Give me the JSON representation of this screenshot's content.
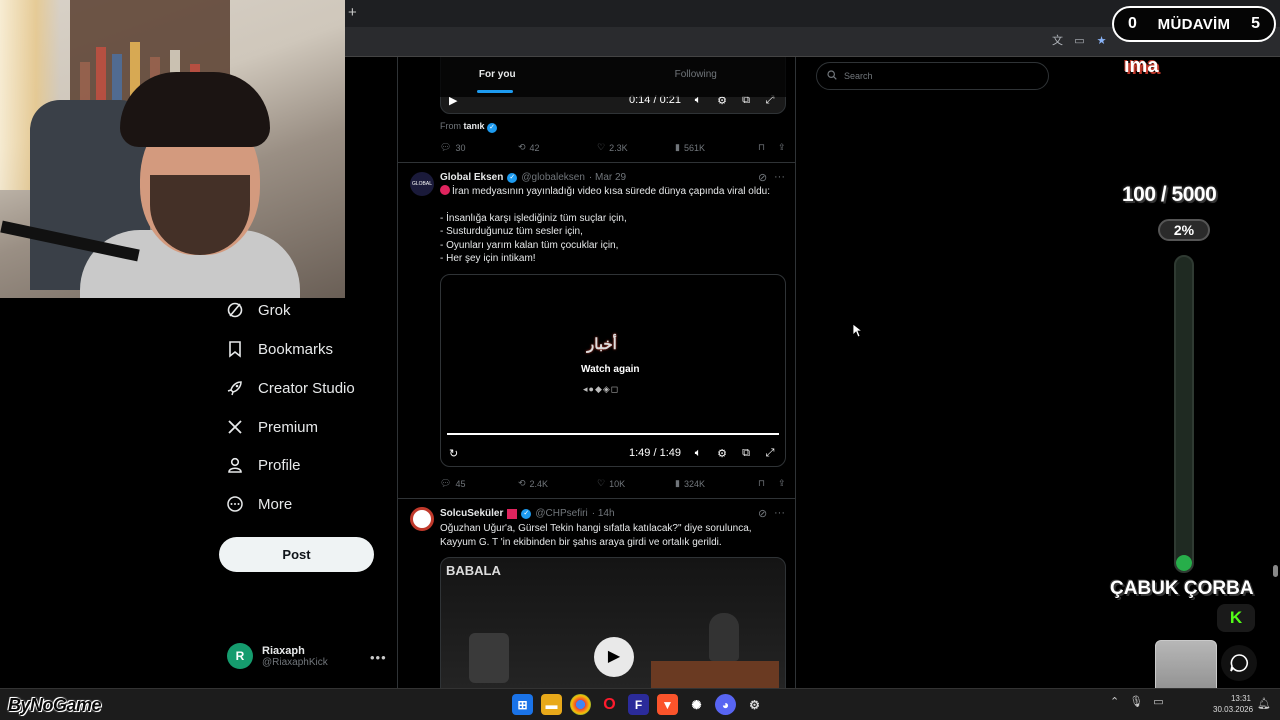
{
  "stream_counter": {
    "left": "0",
    "label": "MÜDAVİM",
    "right": "5"
  },
  "browser": {
    "new_tab": "+"
  },
  "nav": {
    "items": [
      {
        "label": "Grok",
        "icon": "grok-icon"
      },
      {
        "label": "Bookmarks",
        "icon": "bookmark-icon"
      },
      {
        "label": "Creator Studio",
        "icon": "rocket-icon"
      },
      {
        "label": "Premium",
        "icon": "x-logo-icon"
      },
      {
        "label": "Profile",
        "icon": "person-icon"
      },
      {
        "label": "More",
        "icon": "more-circle-icon"
      }
    ],
    "post_label": "Post",
    "account": {
      "avatar_letter": "R",
      "name": "Riaxaph",
      "handle": "@RiaxaphKick"
    }
  },
  "timeline": {
    "tabs": [
      {
        "label": "For you",
        "active": true
      },
      {
        "label": "Following",
        "active": false
      }
    ],
    "tweet0": {
      "video_time": "0:14 / 0:21",
      "from_label": "From",
      "from_user": "tanık",
      "stats": {
        "replies": "30",
        "reposts": "42",
        "likes": "2.3K",
        "views": "561K"
      }
    },
    "tweet1": {
      "avatar_text": "GLOBAL EKSEN",
      "name": "Global Eksen",
      "handle": "@globaleksen",
      "date": "· Mar 29",
      "text_line1": "İran medyasının yayınladığı video kısa sürede dünya çapında viral oldu:",
      "lines": [
        "- İnsanlığa karşı işlediğiniz tüm suçlar için,",
        "- Susturduğunuz tüm sesler için,",
        "- Oyunları yarım kalan tüm çocuklar için,",
        "- Her şey için intikam!"
      ],
      "video_logo": "أخبار",
      "watch_again": "Watch again",
      "video_time": "1:49 / 1:49",
      "stats": {
        "replies": "45",
        "reposts": "2.4K",
        "likes": "10K",
        "views": "324K"
      }
    },
    "tweet2": {
      "name": "SolcuSeküler",
      "handle": "@CHPsefiri",
      "date": "· 14h",
      "text": "Oğuzhan Uğur'a, Gürsel Tekin hangi sıfatla katılacak?\" diye sorulunca, Kayyum G. T 'in ekibinden bir şahıs araya girdi ve ortalık gerildi.",
      "video_logo": "BABALA"
    }
  },
  "search": {
    "placeholder": "Search"
  },
  "overlay": {
    "top_text": "ıma",
    "goal_text": "100 / 5000",
    "percent_text": "2%",
    "progress": 0.02,
    "sponsor_text": "ÇABUK ÇORBA",
    "kick_text": "K"
  },
  "taskbar": {
    "brand": "ByNoGame",
    "apps": [
      "windows-start-icon",
      "file-explorer-icon",
      "chrome-icon",
      "opera-icon",
      "epic-icon",
      "brave-icon",
      "openai-icon",
      "discord-icon",
      "steam-icon"
    ],
    "clock_time": "13:31",
    "clock_date": "30.03.2026"
  },
  "colors": {
    "accent": "#1d9bf0",
    "kick_green": "#53fc18",
    "progress_green": "#27ae4a"
  }
}
